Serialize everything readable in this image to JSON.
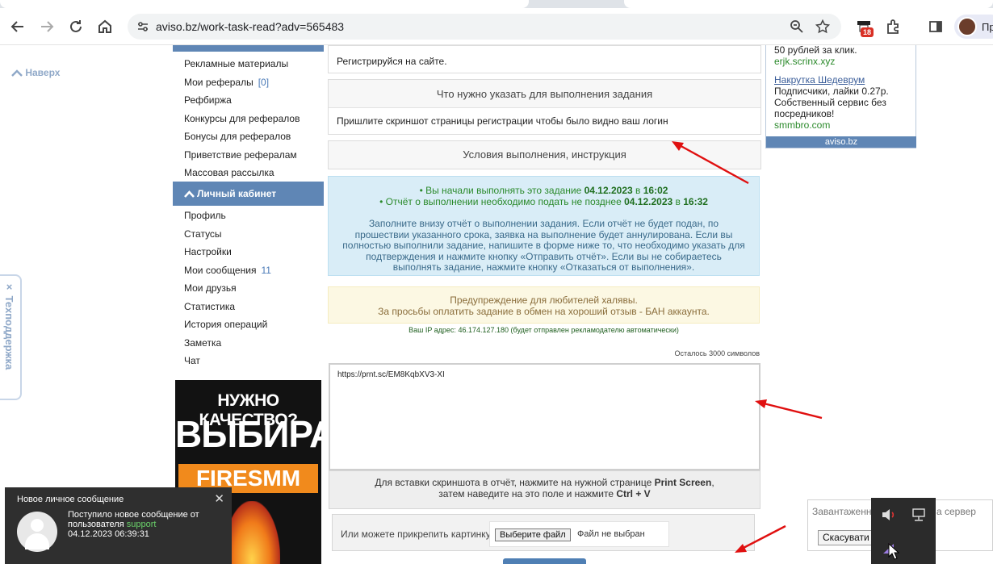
{
  "browser": {
    "url": "aviso.bz/work-task-read?adv=565483",
    "extension_badge": "18",
    "profile_label": "Пр"
  },
  "page": {
    "scroll_top_label": "Наверх",
    "support_tab": "Техподдержка",
    "support_close": "×"
  },
  "sidebar": {
    "items_top": [
      {
        "label": "Рекламные материалы",
        "count": ""
      },
      {
        "label": "Мои рефералы",
        "count": "[0]"
      },
      {
        "label": "Рефбиржа",
        "count": ""
      },
      {
        "label": "Конкурсы для рефералов",
        "count": ""
      },
      {
        "label": "Бонусы для рефералов",
        "count": ""
      },
      {
        "label": "Приветствие рефералам",
        "count": ""
      },
      {
        "label": "Массовая рассылка",
        "count": ""
      }
    ],
    "section_title": "Личный кабинет",
    "items_cabinet": [
      {
        "label": "Профиль",
        "count": ""
      },
      {
        "label": "Статусы",
        "count": ""
      },
      {
        "label": "Настройки",
        "count": ""
      },
      {
        "label": "Мои сообщения",
        "count": "11"
      },
      {
        "label": "Мои друзья",
        "count": ""
      },
      {
        "label": "Статистика",
        "count": ""
      },
      {
        "label": "История операций",
        "count": ""
      },
      {
        "label": "Заметка",
        "count": ""
      },
      {
        "label": "Чат",
        "count": ""
      }
    ],
    "banner": {
      "line1": "НУЖНО КАЧЕСТВО?",
      "line2": "ВЫБИРАЙ",
      "line3": "FIRESMM"
    }
  },
  "task": {
    "register_text": "Регистрируйся на сайте.",
    "what_title": "Что нужно указать для выполнения задания",
    "what_text": "Пришлите скриншот страницы регистрации чтобы было видно ваш логин",
    "conditions_title": "Условия выполнения, инструкция",
    "info": {
      "started_prefix": "• Вы начали выполнять это задание ",
      "started_date": "04.12.2023",
      "started_mid": " в ",
      "started_time": "16:02",
      "deadline_prefix": "• Отчёт о выполнении необходимо подать не позднее ",
      "deadline_date": "04.12.2023",
      "deadline_mid": " в ",
      "deadline_time": "16:32",
      "description": "Заполните внизу отчёт о выполнении задания. Если отчёт не будет подан, по прошествии указанного срока, заявка на выполнение будет аннулирована. Если вы полностью выполнили задание, напишите в форме ниже то, что необходимо указать для подтверждения и нажмите кнопку «Отправить отчёт». Если вы не собираетесь выполнять задание, нажмите кнопку «Отказаться от выполнения»."
    },
    "warning_line1": "Предупреждение для любителей халявы.",
    "warning_line2": "За просьбы оплатить задание в обмен на хороший отзыв - БАН аккаунта.",
    "ip_label": "Ваш IP адрес:",
    "ip_value": "46.174.127.180",
    "ip_note": "(будет отправлен рекламодателю автоматически)",
    "chars_left": "Осталось 3000 символов",
    "report_value": "https://prnt.sc/EM8KqbXV3-XI",
    "paste_hint_prefix": "Для вставки скриншота в отчёт, нажмите на нужной странице ",
    "paste_hint_key1": "Print Screen",
    "paste_hint_mid": "затем наведите на это поле и нажмите ",
    "paste_hint_key2": "Ctrl + V",
    "attach_label": "Или можете прикрепить картинку",
    "file_button": "Выберите файл",
    "file_none": "Файл не выбран"
  },
  "ads": {
    "ad1_desc": "50 рублей за клик.",
    "ad1_domain": "erjk.scrinx.xyz",
    "ad2_title": "Накрутка Шедеврум",
    "ad2_line1": "Подписчики, лайки 0.27р.",
    "ad2_line2": "Собственный сервис без",
    "ad2_line3": "посредников!",
    "ad2_domain": "smmbro.com",
    "footer": "aviso.bz"
  },
  "notification": {
    "title": "Новое личное сообщение",
    "close": "✕",
    "line1": "Поступило новое сообщение от",
    "line2_prefix": "пользователя ",
    "user": "support",
    "datetime": "04.12.2023 06:39:31"
  },
  "download": {
    "text_left": "Завантаженн",
    "text_right": "а сервер",
    "cancel_button": "Скасувати"
  }
}
